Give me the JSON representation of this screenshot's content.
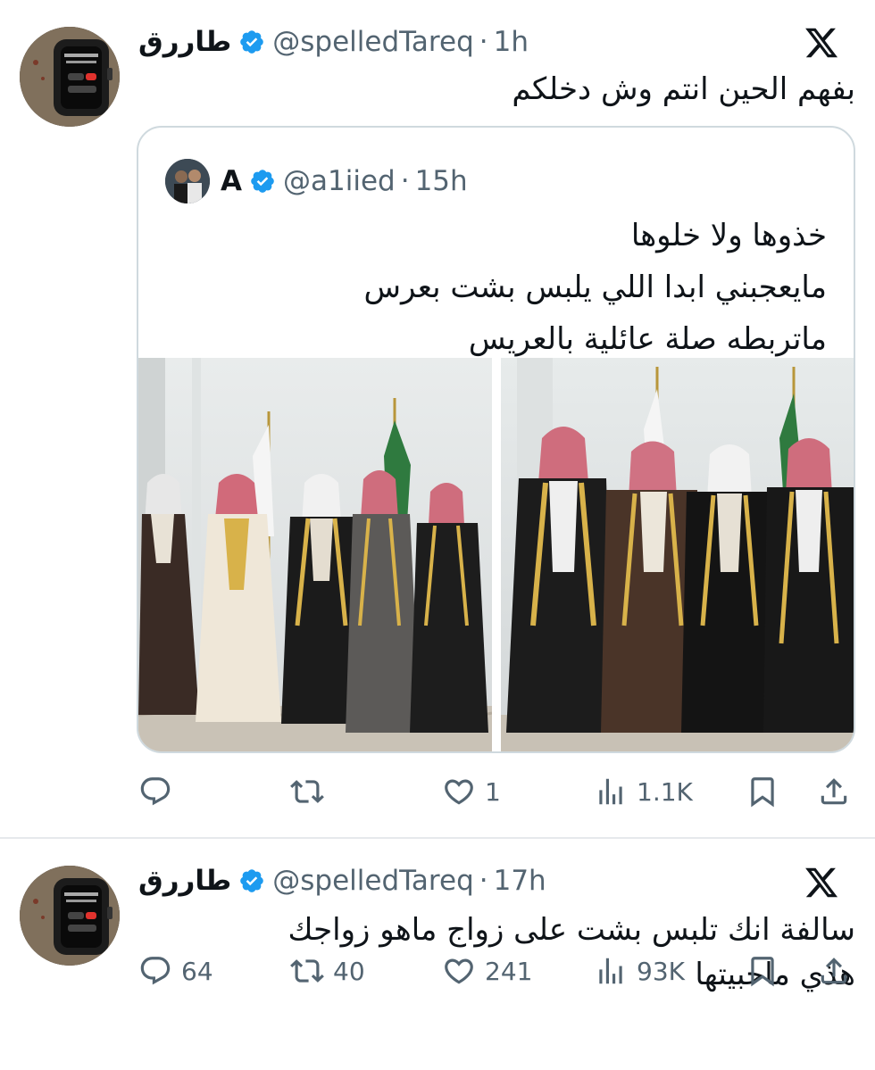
{
  "main_tweet": {
    "author_name": "طاررق",
    "handle": "@spelledTareq",
    "separator": "·",
    "time": "1h",
    "text_lines": [
      "بفهم الحين انتم وش دخلكم"
    ],
    "quoted": {
      "author_name": "A",
      "handle": "@a1iied",
      "separator": "·",
      "time": "15h",
      "text_lines": [
        "خذوها ولا خلوها",
        "مايعجبني ابدا اللي يلبس بشت بعرس",
        "ماتربطه صلة عائلية بالعريس"
      ]
    },
    "actions": {
      "replies": "",
      "retweets": "",
      "likes": "1",
      "views": "1.1K"
    }
  },
  "reply_tweet": {
    "author_name": "طاررق",
    "handle": "@spelledTareq",
    "separator": "·",
    "time": "17h",
    "text_lines": [
      "سالفة انك تلبس بشت على زواج ماهو زواجك",
      "هذي ماحبيتها"
    ],
    "actions": {
      "replies": "64",
      "retweets": "40",
      "likes": "241",
      "views": "93K"
    }
  },
  "icons": {
    "verified": "verified-badge-icon",
    "platform": "x-logo-icon",
    "reply": "reply-icon",
    "retweet": "retweet-icon",
    "like": "heart-icon",
    "views": "views-icon",
    "bookmark": "bookmark-icon",
    "share": "share-icon"
  },
  "colors": {
    "verified": "#1d9bf0",
    "icon": "#536471",
    "text": "#0f1419",
    "border": "#cfd9de"
  }
}
